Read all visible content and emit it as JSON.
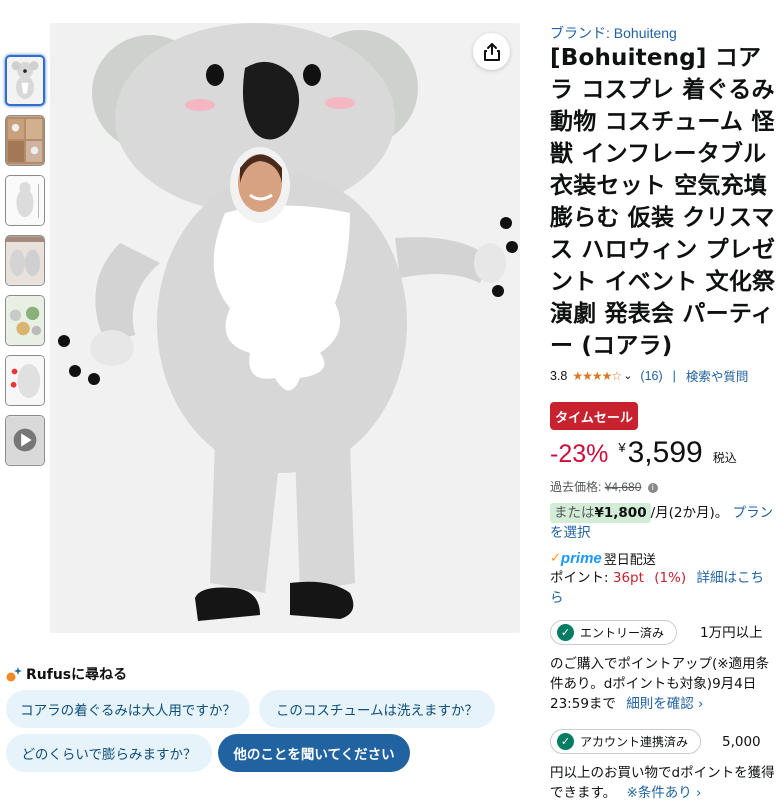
{
  "thumbnails": [
    {
      "alt": "thumb-1"
    },
    {
      "alt": "thumb-2"
    },
    {
      "alt": "thumb-3"
    },
    {
      "alt": "thumb-4"
    },
    {
      "alt": "thumb-5"
    },
    {
      "alt": "thumb-6"
    },
    {
      "alt": "thumb-7"
    }
  ],
  "rufus": {
    "title": "Rufusに尋ねる",
    "chips": [
      "コアラの着ぐるみは大人用ですか？",
      "このコスチュームは洗えますか？",
      "どのくらいで膨らみますか？",
      "他のことを聞いてください"
    ]
  },
  "product": {
    "brand": "ブランド: Bohuiteng",
    "title": "[Bohuiteng] コアラ コスプレ 着ぐるみ 動物 コスチューム 怪獣 インフレータブル 衣装セット 空気充填 膨らむ 仮装 クリスマス ハロウィン プレゼント イベント 文化祭 演劇 発表会 パーティー (コアラ)",
    "rating": "3.8",
    "stars": "★★★★☆",
    "review_count": "(16)",
    "separator": "|",
    "search_link": "検索や質問",
    "sale_badge": "タイムセール",
    "discount": "-23%",
    "currency": "¥",
    "price": "3,599",
    "tax": "税込",
    "past_price_label": "過去価格:",
    "past_price": "¥4,680",
    "monthly_prefix": "または",
    "monthly_amount": "¥1,800",
    "monthly_suffix": "/月(2か月)。",
    "monthly_link": "プランを選択",
    "prime_check": "✓",
    "prime_label": "prime",
    "delivery": "翌日配送",
    "points_label": "ポイント:",
    "points_value": "36pt",
    "points_pct": "(1%)",
    "points_link": "詳細はこちら",
    "promo1_badge": "エントリー済み",
    "promo1_after": "1万円以上",
    "promo1_text": "のご購入でポイントアップ(※適用条件あり。dポイントも対象)9月4日 23:59まで",
    "promo1_link": "細則を確認 ›",
    "promo2_badge": "アカウント連携済み",
    "promo2_after": "5,000",
    "promo2_text": "円以上のお買い物でdポイントを獲得できます。",
    "promo2_link": "※条件あり ›"
  },
  "colors": {
    "link": "#2162a1",
    "sale": "#c7222e",
    "discount": "#cc0c39",
    "star": "#de7921",
    "prime": "#1a98ff"
  }
}
